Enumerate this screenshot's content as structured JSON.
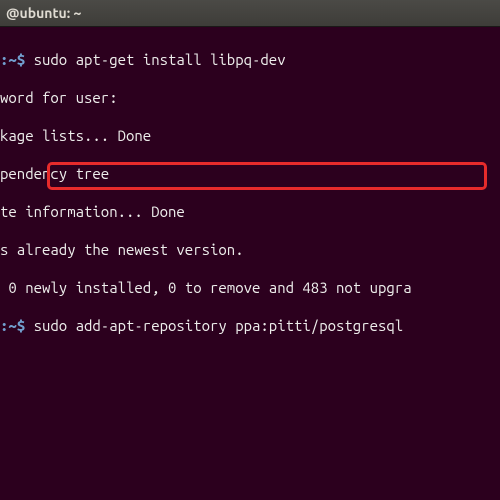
{
  "titlebar": {
    "text": "@ubuntu: ~"
  },
  "prompt": {
    "path": ":~$ "
  },
  "lines": {
    "l0_cmd": "sudo apt-get install libpq-dev",
    "l1": "word for user:",
    "l2": "kage lists... Done",
    "l3": "pendency tree",
    "l4": "te information... Done",
    "l5": "s already the newest version.",
    "l6": " 0 newly installed, 0 to remove and 483 not upgra",
    "l7_cmd": "sudo add-apt-repository ppa:pitti/postgresql"
  }
}
